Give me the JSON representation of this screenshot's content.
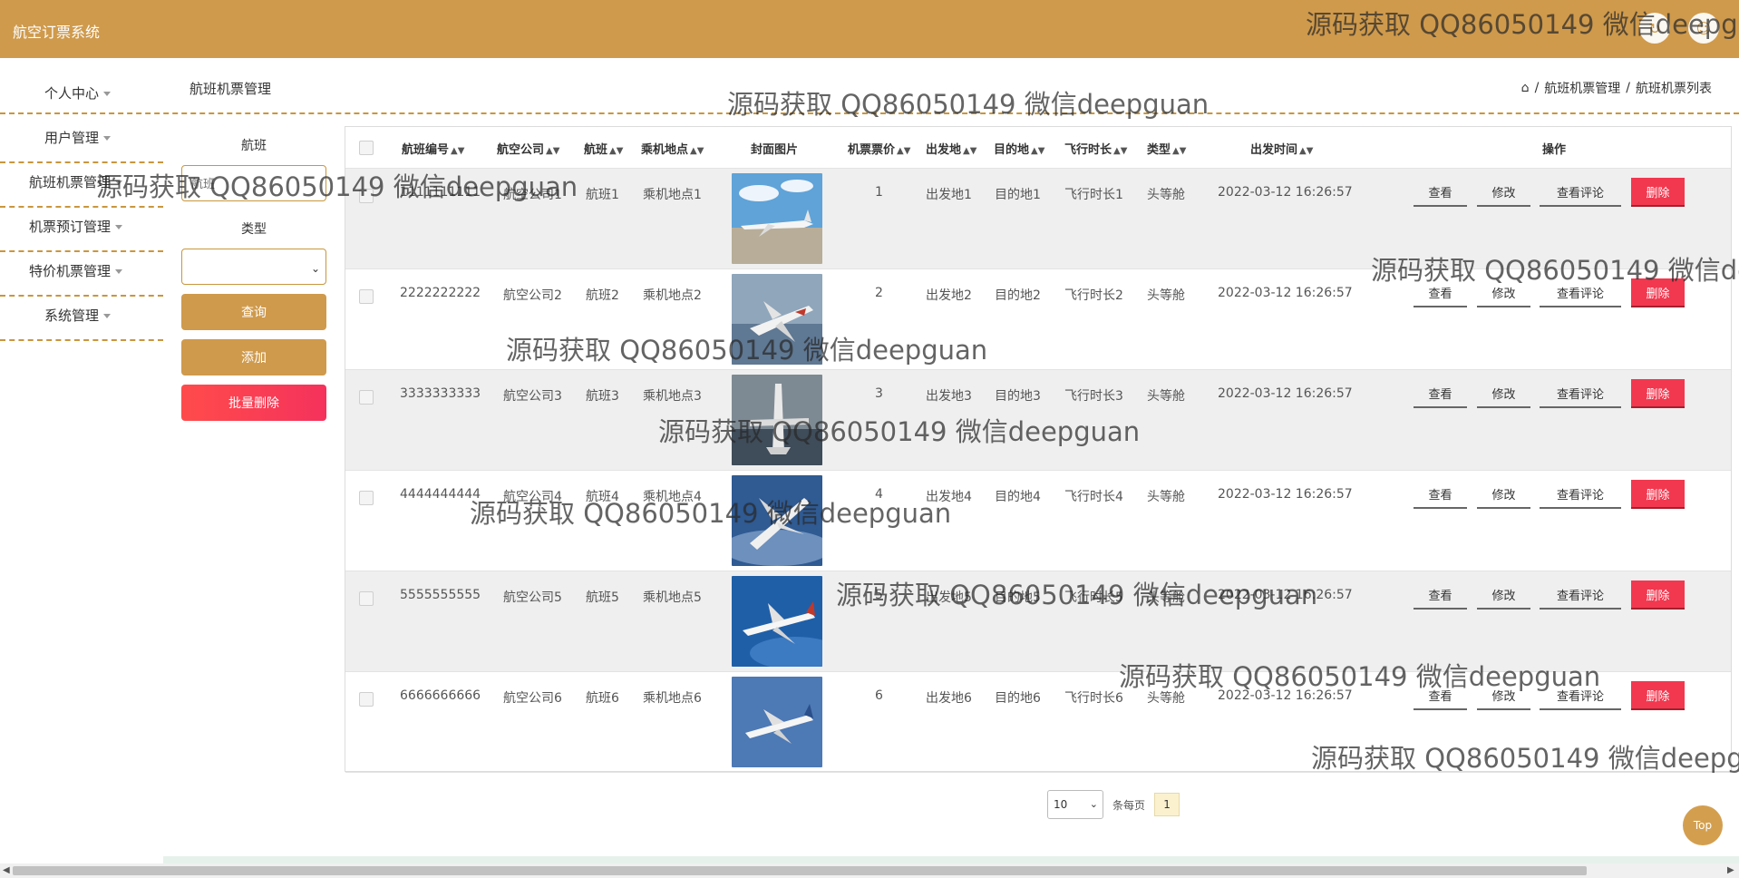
{
  "app": {
    "title": "航空订票系统"
  },
  "header_icons": [
    "refresh-icon",
    "user-icon"
  ],
  "sidebar": {
    "items": [
      {
        "label": "个人中心"
      },
      {
        "label": "用户管理"
      },
      {
        "label": "航班机票管理"
      },
      {
        "label": "机票预订管理"
      },
      {
        "label": "特价机票管理"
      },
      {
        "label": "系统管理"
      }
    ]
  },
  "page": {
    "title": "航班机票管理",
    "breadcrumb": [
      "航班机票管理",
      "航班机票列表"
    ]
  },
  "search": {
    "flight_label": "航班",
    "flight_placeholder": "航班",
    "type_label": "类型",
    "type_value": "",
    "query_label": "查询",
    "add_label": "添加",
    "batch_delete_label": "批量删除"
  },
  "table": {
    "columns": [
      "航班编号",
      "航空公司",
      "航班",
      "乘机地点",
      "封面图片",
      "机票票价",
      "出发地",
      "目的地",
      "飞行时长",
      "类型",
      "出发时间",
      "操作"
    ],
    "rows": [
      {
        "no": "1111111111",
        "airline": "航空公司1",
        "flight": "航班1",
        "boarding": "乘机地点1",
        "price": "1",
        "from": "出发地1",
        "to": "目的地1",
        "duration": "飞行时长1",
        "type": "头等舱",
        "time": "2022-03-12 16:26:57"
      },
      {
        "no": "2222222222",
        "airline": "航空公司2",
        "flight": "航班2",
        "boarding": "乘机地点2",
        "price": "2",
        "from": "出发地2",
        "to": "目的地2",
        "duration": "飞行时长2",
        "type": "头等舱",
        "time": "2022-03-12 16:26:57"
      },
      {
        "no": "3333333333",
        "airline": "航空公司3",
        "flight": "航班3",
        "boarding": "乘机地点3",
        "price": "3",
        "from": "出发地3",
        "to": "目的地3",
        "duration": "飞行时长3",
        "type": "头等舱",
        "time": "2022-03-12 16:26:57"
      },
      {
        "no": "4444444444",
        "airline": "航空公司4",
        "flight": "航班4",
        "boarding": "乘机地点4",
        "price": "4",
        "from": "出发地4",
        "to": "目的地4",
        "duration": "飞行时长4",
        "type": "头等舱",
        "time": "2022-03-12 16:26:57"
      },
      {
        "no": "5555555555",
        "airline": "航空公司5",
        "flight": "航班5",
        "boarding": "乘机地点5",
        "price": "5",
        "from": "出发地5",
        "to": "目的地5",
        "duration": "飞行时长5",
        "type": "头等舱",
        "time": "2022-03-12 16:26:57"
      },
      {
        "no": "6666666666",
        "airline": "航空公司6",
        "flight": "航班6",
        "boarding": "乘机地点6",
        "price": "6",
        "from": "出发地6",
        "to": "目的地6",
        "duration": "飞行时长6",
        "type": "头等舱",
        "time": "2022-03-12 16:26:57"
      }
    ],
    "actions": {
      "view": "查看",
      "edit": "修改",
      "comments": "查看评论",
      "delete": "删除"
    }
  },
  "pager": {
    "page_size": "10",
    "per_page_label": "条每页",
    "current_page": "1"
  },
  "top_button": "Top",
  "watermark": "源码获取 QQ86050149 微信deepguan",
  "colors": {
    "accent": "#cf9a4c",
    "danger": "#f2384f",
    "dash": "#c9963e"
  }
}
